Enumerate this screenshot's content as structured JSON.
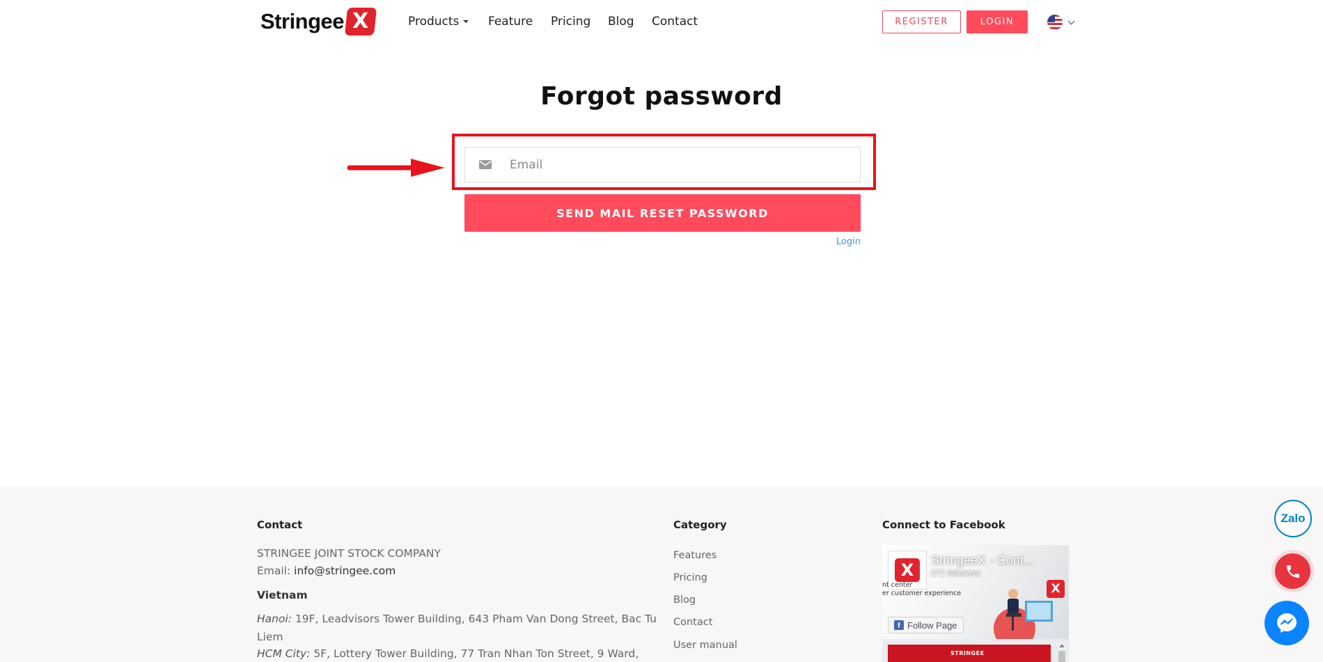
{
  "header": {
    "logo_text": "Stringee",
    "logo_mark": "X",
    "nav": [
      {
        "label": "Products",
        "has_caret": true
      },
      {
        "label": "Feature"
      },
      {
        "label": "Pricing"
      },
      {
        "label": "Blog"
      },
      {
        "label": "Contact"
      }
    ],
    "register_label": "REGISTER",
    "login_label": "LOGIN",
    "language_icon": "us-flag-icon"
  },
  "main": {
    "title": "Forgot password",
    "email_placeholder": "Email",
    "email_value": "",
    "email_icon": "envelope-icon",
    "send_button": "SEND MAIL RESET PASSWORD",
    "login_link": "Login"
  },
  "annotation": {
    "arrow_color": "#e8131c",
    "box_color": "#e8131c"
  },
  "footer": {
    "contact": {
      "heading": "Contact",
      "company": "STRINGEE JOINT STOCK COMPANY",
      "email_label": "Email:",
      "email_value": "info@stringee.com",
      "region": "Vietnam",
      "hanoi_label": "Hanoi:",
      "hanoi_address_line1": "19F, Leadvisors Tower Building, 643 Pham Van Dong Street, Bac Tu",
      "hanoi_address_line2": "Liem",
      "hcm_label": "HCM City:",
      "hcm_address": "5F, Lottery Tower Building, 77 Tran Nhan Ton Street, 9 Ward,"
    },
    "category": {
      "heading": "Category",
      "links": [
        "Features",
        "Pricing",
        "Blog",
        "Contact",
        "User manual"
      ]
    },
    "facebook": {
      "heading": "Connect to Facebook",
      "page_name": "StringeeX - Cont...",
      "followers": "171 followers",
      "tagline_1": "nt center",
      "tagline_2": "er customer experience",
      "follow_label": "Follow Page",
      "post_label": "STRINGEE"
    }
  },
  "widgets": {
    "zalo_label": "Zalo",
    "call_icon": "phone-icon",
    "messenger_icon": "messenger-icon"
  },
  "colors": {
    "brand_red": "#ff4b5c",
    "logo_red": "#e0242e",
    "link_blue": "#4a90d9"
  }
}
